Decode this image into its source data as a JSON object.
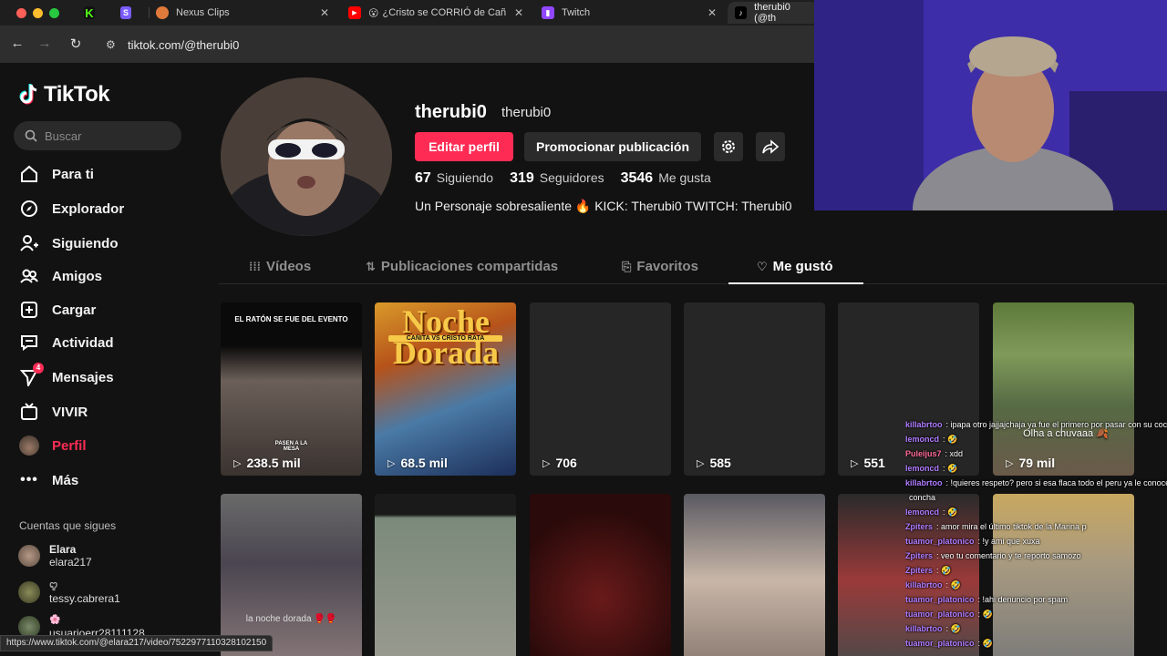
{
  "browser": {
    "tabs": [
      {
        "label": "",
        "icon": "kick-icon"
      },
      {
        "label": "",
        "icon": "s-icon"
      },
      {
        "label": "Nexus Clips",
        "icon": "nexus-icon"
      },
      {
        "label": "¿Cristo se CORRIÓ de Cañ",
        "icon": "youtube-icon"
      },
      {
        "label": "Twitch",
        "icon": "twitch-icon"
      },
      {
        "label": "therubi0 (@th",
        "icon": "tiktok-icon"
      }
    ],
    "url": "tiktok.com/@therubi0",
    "status_url": "https://www.tiktok.com/@elara217/video/7522977110328102150"
  },
  "sidebar": {
    "logo": "TikTok",
    "search_placeholder": "Buscar",
    "items": [
      {
        "label": "Para ti",
        "icon": "home-icon"
      },
      {
        "label": "Explorador",
        "icon": "compass-icon"
      },
      {
        "label": "Siguiendo",
        "icon": "person-plus-icon"
      },
      {
        "label": "Amigos",
        "icon": "friends-icon"
      },
      {
        "label": "Cargar",
        "icon": "upload-icon"
      },
      {
        "label": "Actividad",
        "icon": "activity-icon"
      },
      {
        "label": "Mensajes",
        "icon": "send-icon",
        "badge": "4"
      },
      {
        "label": "VIVIR",
        "icon": "live-tv-icon"
      },
      {
        "label": "Perfil",
        "icon": "avatar-icon"
      },
      {
        "label": "Más",
        "icon": "more-icon"
      }
    ],
    "following_title": "Cuentas que sigues",
    "following": [
      {
        "name": "Elara",
        "username": "elara217"
      },
      {
        "name": "ꨄ",
        "username": "tessy.cabrera1"
      },
      {
        "name": "🌸",
        "username": "usuarioerr28111128"
      }
    ]
  },
  "profile": {
    "username": "therubi0",
    "nickname": "therubi0",
    "edit_label": "Editar perfil",
    "promote_label": "Promocionar publicación",
    "stats": [
      {
        "value": "67",
        "label": "Siguiendo"
      },
      {
        "value": "319",
        "label": "Seguidores"
      },
      {
        "value": "3546",
        "label": "Me gusta"
      }
    ],
    "bio": "Un Personaje sobresaliente 🔥 KICK: Therubi0 TWITCH: Therubi0"
  },
  "tabs": [
    {
      "label": "Vídeos",
      "icon": "grid-icon"
    },
    {
      "label": "Publicaciones compartidas",
      "icon": "repost-icon"
    },
    {
      "label": "Favoritos",
      "icon": "bookmark-icon"
    },
    {
      "label": "Me gustó",
      "icon": "heart-icon"
    }
  ],
  "videos": [
    {
      "views": "238.5 mil",
      "caption": "EL RATÓN SE FUE DEL EVENTO",
      "caption2": "PASEN A LA MESA"
    },
    {
      "views": "68.5 mil",
      "caption": "Noche Dorada",
      "caption2": "CAÑITA VS CRISTO RATA"
    },
    {
      "views": "706"
    },
    {
      "views": "585"
    },
    {
      "views": "551"
    },
    {
      "views": "79 mil",
      "caption": "Olha a chuvaaa 🍂"
    },
    {
      "views": "",
      "caption": "la noche dorada 🥊🥊"
    },
    {
      "views": ""
    },
    {
      "views": ""
    },
    {
      "views": ""
    },
    {
      "views": ""
    },
    {
      "views": ""
    }
  ],
  "chat": [
    {
      "user": "killabrtoo",
      "msg": ": ipapa otro jajjajchaja ya fue el primero por pasar con su cocina",
      "color": "#b07cff"
    },
    {
      "user": "lemoncd",
      "msg": ": 🤣",
      "color": "#b07cff"
    },
    {
      "user": "Puleijus7",
      "msg": ": xdd",
      "color": "#ff6b9a"
    },
    {
      "user": "lemoncd",
      "msg": ": 🤣",
      "color": "#b07cff"
    },
    {
      "user": "killabrtoo",
      "msg": ": !quieres respeto? pero si esa flaca todo el peru ya le conoce la",
      "color": "#b07cff"
    },
    {
      "user": "",
      "msg": "concha",
      "color": "#ffffff"
    },
    {
      "user": "lemoncd",
      "msg": ": 🤣",
      "color": "#b07cff"
    },
    {
      "user": "Zpiters",
      "msg": ": amor mira el último tiktok de la Marina p",
      "color": "#b07cff"
    },
    {
      "user": "tuamor_platonico",
      "msg": ": !y ami que xuxa",
      "color": "#b07cff"
    },
    {
      "user": "Zpiters",
      "msg": ": veo tu comentario y te reporto samozo",
      "color": "#b07cff"
    },
    {
      "user": "Zpiters",
      "msg": ": 🤣",
      "color": "#b07cff"
    },
    {
      "user": "killabrtoo",
      "msg": ": 🤣",
      "color": "#b07cff"
    },
    {
      "user": "tuamor_platonico",
      "msg": ": !ahi denuncio por spam",
      "color": "#b07cff"
    },
    {
      "user": "tuamor_platonico",
      "msg": ": 🤣",
      "color": "#b07cff"
    },
    {
      "user": "killabrtoo",
      "msg": ": 🤣",
      "color": "#b07cff"
    },
    {
      "user": "tuamor_platonico",
      "msg": ": 🤣",
      "color": "#b07cff"
    }
  ],
  "colors": {
    "accent": "#fe2c55",
    "bg": "#121212"
  }
}
